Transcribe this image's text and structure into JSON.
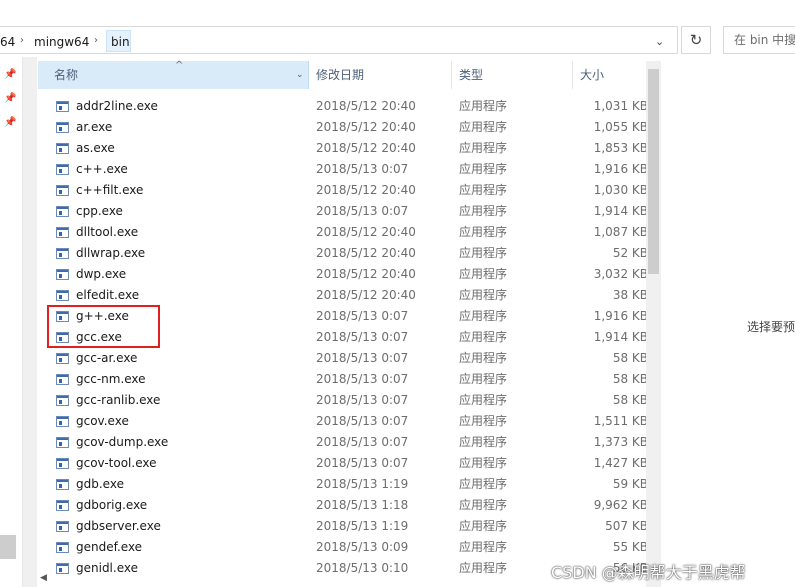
{
  "address": {
    "crumbs": [
      "64",
      "mingw64",
      "bin"
    ],
    "separator": "›",
    "dropdown_icon": "chevron-down-icon",
    "refresh_icon": "refresh-icon",
    "search_placeholder": "在 bin 中搜"
  },
  "columns": {
    "name": "名称",
    "date": "修改日期",
    "type": "类型",
    "size": "大小",
    "sort_indicator": "^",
    "name_filter_icon": "⌄"
  },
  "files": [
    {
      "name": "addr2line.exe",
      "date": "2018/5/12 20:40",
      "type": "应用程序",
      "size": "1,031 KB"
    },
    {
      "name": "ar.exe",
      "date": "2018/5/12 20:40",
      "type": "应用程序",
      "size": "1,055 KB"
    },
    {
      "name": "as.exe",
      "date": "2018/5/12 20:40",
      "type": "应用程序",
      "size": "1,853 KB"
    },
    {
      "name": "c++.exe",
      "date": "2018/5/13 0:07",
      "type": "应用程序",
      "size": "1,916 KB"
    },
    {
      "name": "c++filt.exe",
      "date": "2018/5/12 20:40",
      "type": "应用程序",
      "size": "1,030 KB"
    },
    {
      "name": "cpp.exe",
      "date": "2018/5/13 0:07",
      "type": "应用程序",
      "size": "1,914 KB"
    },
    {
      "name": "dlltool.exe",
      "date": "2018/5/12 20:40",
      "type": "应用程序",
      "size": "1,087 KB"
    },
    {
      "name": "dllwrap.exe",
      "date": "2018/5/12 20:40",
      "type": "应用程序",
      "size": "52 KB"
    },
    {
      "name": "dwp.exe",
      "date": "2018/5/12 20:40",
      "type": "应用程序",
      "size": "3,032 KB"
    },
    {
      "name": "elfedit.exe",
      "date": "2018/5/12 20:40",
      "type": "应用程序",
      "size": "38 KB"
    },
    {
      "name": "g++.exe",
      "date": "2018/5/13 0:07",
      "type": "应用程序",
      "size": "1,916 KB"
    },
    {
      "name": "gcc.exe",
      "date": "2018/5/13 0:07",
      "type": "应用程序",
      "size": "1,914 KB"
    },
    {
      "name": "gcc-ar.exe",
      "date": "2018/5/13 0:07",
      "type": "应用程序",
      "size": "58 KB"
    },
    {
      "name": "gcc-nm.exe",
      "date": "2018/5/13 0:07",
      "type": "应用程序",
      "size": "58 KB"
    },
    {
      "name": "gcc-ranlib.exe",
      "date": "2018/5/13 0:07",
      "type": "应用程序",
      "size": "58 KB"
    },
    {
      "name": "gcov.exe",
      "date": "2018/5/13 0:07",
      "type": "应用程序",
      "size": "1,511 KB"
    },
    {
      "name": "gcov-dump.exe",
      "date": "2018/5/13 0:07",
      "type": "应用程序",
      "size": "1,373 KB"
    },
    {
      "name": "gcov-tool.exe",
      "date": "2018/5/13 0:07",
      "type": "应用程序",
      "size": "1,427 KB"
    },
    {
      "name": "gdb.exe",
      "date": "2018/5/13 1:19",
      "type": "应用程序",
      "size": "59 KB"
    },
    {
      "name": "gdborig.exe",
      "date": "2018/5/13 1:18",
      "type": "应用程序",
      "size": "9,962 KB"
    },
    {
      "name": "gdbserver.exe",
      "date": "2018/5/13 1:19",
      "type": "应用程序",
      "size": "507 KB"
    },
    {
      "name": "gendef.exe",
      "date": "2018/5/13 0:09",
      "type": "应用程序",
      "size": "55 KB"
    },
    {
      "name": "genidl.exe",
      "date": "2018/5/13 0:10",
      "type": "应用程序",
      "size": "56 KB"
    }
  ],
  "preview_text": "选择要预",
  "watermark": "CSDN @森明帮大于黑虎帮",
  "colors": {
    "header_selected": "#d9ebf9",
    "highlight_border": "#e02020",
    "secondary_text": "#6d6d6d"
  }
}
